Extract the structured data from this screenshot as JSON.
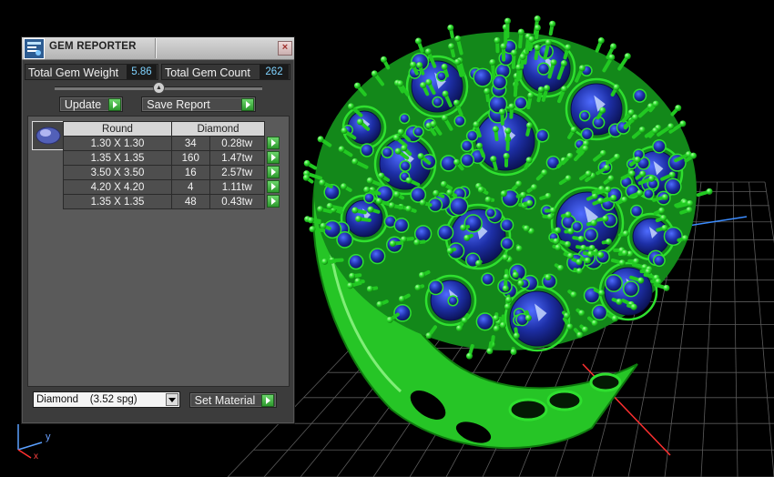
{
  "window": {
    "title": "GEM REPORTER",
    "close_glyph": "×"
  },
  "stats": {
    "weight_label": "Total Gem Weight",
    "weight_value": "5.86",
    "count_label": "Total Gem Count",
    "count_value": "262"
  },
  "toolbar": {
    "update_label": "Update",
    "save_report_label": "Save Report"
  },
  "table": {
    "headers": [
      "Round",
      "Diamond"
    ],
    "rows": [
      {
        "size": "1.30 X 1.30",
        "count": "34",
        "weight": "0.28tw"
      },
      {
        "size": "1.35 X 1.35",
        "count": "160",
        "weight": "1.47tw"
      },
      {
        "size": "3.50 X 3.50",
        "count": "16",
        "weight": "2.57tw"
      },
      {
        "size": "4.20 X 4.20",
        "count": "4",
        "weight": "1.11tw"
      },
      {
        "size": "1.35 X 1.35",
        "count": "48",
        "weight": "0.43tw"
      }
    ]
  },
  "material": {
    "selected": "Diamond    (3.52 spg)",
    "set_material_label": "Set Material"
  },
  "axes": {
    "y_label": "y",
    "x_label": "x"
  },
  "colors": {
    "ring_metal": "#2fe02f",
    "gem": "#1c2ea8",
    "accent_value": "#7fd3ff",
    "action_arrow": "#3cb83c"
  },
  "icons": {
    "app": "gem-reporter-app-icon",
    "close": "close-icon",
    "row_action": "play-arrow-icon",
    "dropdown": "chevron-down-icon"
  }
}
